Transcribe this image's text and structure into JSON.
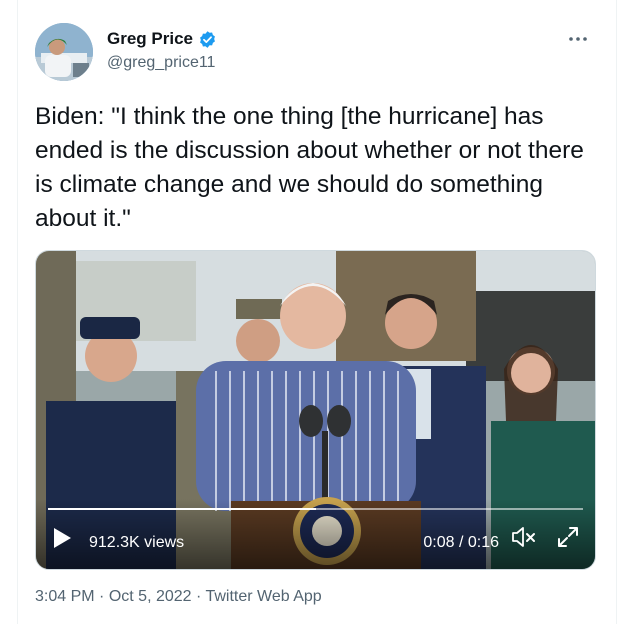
{
  "author": {
    "name": "Greg Price",
    "handle": "@greg_price11",
    "verified": true,
    "verified_color": "#1d9bf0"
  },
  "more_icon": "ellipsis-icon",
  "tweet": {
    "text": "Biden: \"I think the one thing [the hurricane] has ended is the discussion about whether or not there is climate change and we should do something about it.\""
  },
  "video": {
    "views": "912.3K views",
    "time": "0:08 / 0:16",
    "progress": 0.5
  },
  "meta": {
    "time": "3:04 PM",
    "separator": "·",
    "date": "Oct 5, 2022",
    "source": "Twitter Web App"
  }
}
